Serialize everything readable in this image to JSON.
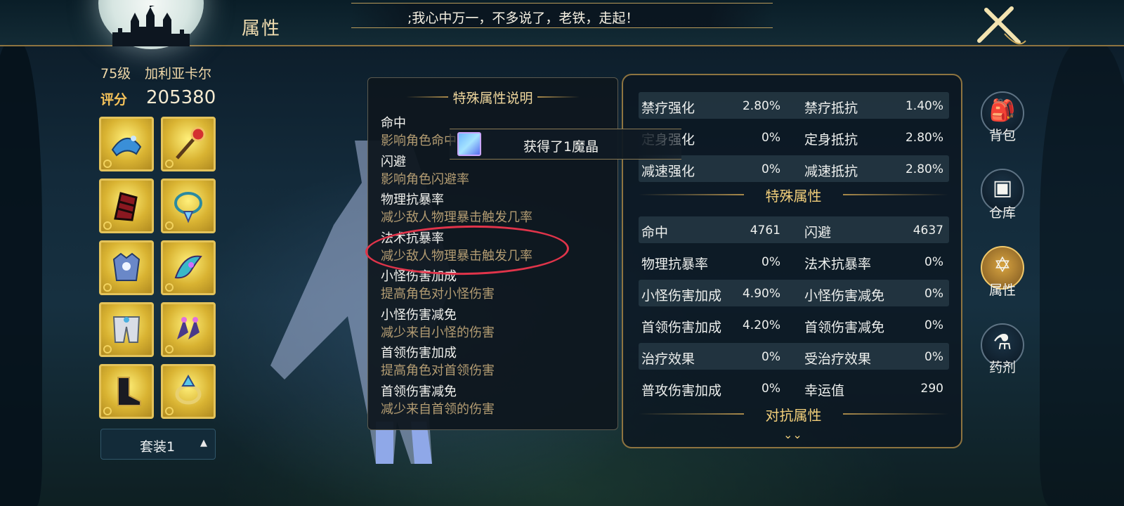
{
  "header": {
    "title": "属性",
    "broadcast": ";我心中万一，不多说了，老铁，走起！"
  },
  "player": {
    "level": "75级",
    "name": "加利亚卡尔",
    "score_label": "评分",
    "score": "205380"
  },
  "equipment": {
    "slots": [
      {
        "icon": "hat-icon"
      },
      {
        "icon": "staff-icon"
      },
      {
        "icon": "gauntlet-icon"
      },
      {
        "icon": "necklace-icon"
      },
      {
        "icon": "armor-icon"
      },
      {
        "icon": "bracelet-icon"
      },
      {
        "icon": "pants-icon"
      },
      {
        "icon": "earring-icon"
      },
      {
        "icon": "boots-icon"
      },
      {
        "icon": "ring-icon"
      }
    ],
    "suit_label": "套装1"
  },
  "description_panel": {
    "title": "特殊属性说明",
    "items": [
      {
        "name": "命中",
        "text": "影响角色命中率"
      },
      {
        "name": "闪避",
        "text": "影响角色闪避率"
      },
      {
        "name": "物理抗暴率",
        "text": "减少敌人物理暴击触发几率"
      },
      {
        "name": "法术抗暴率",
        "text": "减少敌人物理暴击触发几率"
      },
      {
        "name": "小怪伤害加成",
        "text": "提高角色对小怪伤害"
      },
      {
        "name": "小怪伤害减免",
        "text": "减少来自小怪的伤害"
      },
      {
        "name": "首领伤害加成",
        "text": "提高角色对首领伤害"
      },
      {
        "name": "首领伤害减免",
        "text": "减少来自首领的伤害"
      }
    ]
  },
  "toast": {
    "text": "获得了1魔晶"
  },
  "stats": {
    "control_rows": [
      {
        "n1": "禁疗强化",
        "v1": "2.80%",
        "n2": "禁疗抵抗",
        "v2": "1.40%"
      },
      {
        "n1": "定身强化",
        "v1": "0%",
        "n2": "定身抵抗",
        "v2": "2.80%"
      },
      {
        "n1": "减速强化",
        "v1": "0%",
        "n2": "减速抵抗",
        "v2": "2.80%"
      }
    ],
    "special_header": "特殊属性",
    "special_rows": [
      {
        "n1": "命中",
        "v1": "4761",
        "n2": "闪避",
        "v2": "4637"
      },
      {
        "n1": "物理抗暴率",
        "v1": "0%",
        "n2": "法术抗暴率",
        "v2": "0%"
      },
      {
        "n1": "小怪伤害加成",
        "v1": "4.90%",
        "n2": "小怪伤害减免",
        "v2": "0%"
      },
      {
        "n1": "首领伤害加成",
        "v1": "4.20%",
        "n2": "首领伤害减免",
        "v2": "0%"
      },
      {
        "n1": "治疗效果",
        "v1": "0%",
        "n2": "受治疗效果",
        "v2": "0%"
      },
      {
        "n1": "普攻伤害加成",
        "v1": "0%",
        "n2": "幸运值",
        "v2": "290"
      }
    ],
    "resist_header": "对抗属性"
  },
  "side_menu": [
    {
      "label": "背包",
      "icon": "backpack-icon",
      "active": false
    },
    {
      "label": "仓库",
      "icon": "chest-icon",
      "active": false
    },
    {
      "label": "属性",
      "icon": "hexagram-icon",
      "active": true
    },
    {
      "label": "药剂",
      "icon": "potion-icon",
      "active": false
    }
  ],
  "colors": {
    "gold": "#f1ce7a",
    "highlight_ring": "#e0344a",
    "slot_gold": "#e4c35a"
  }
}
